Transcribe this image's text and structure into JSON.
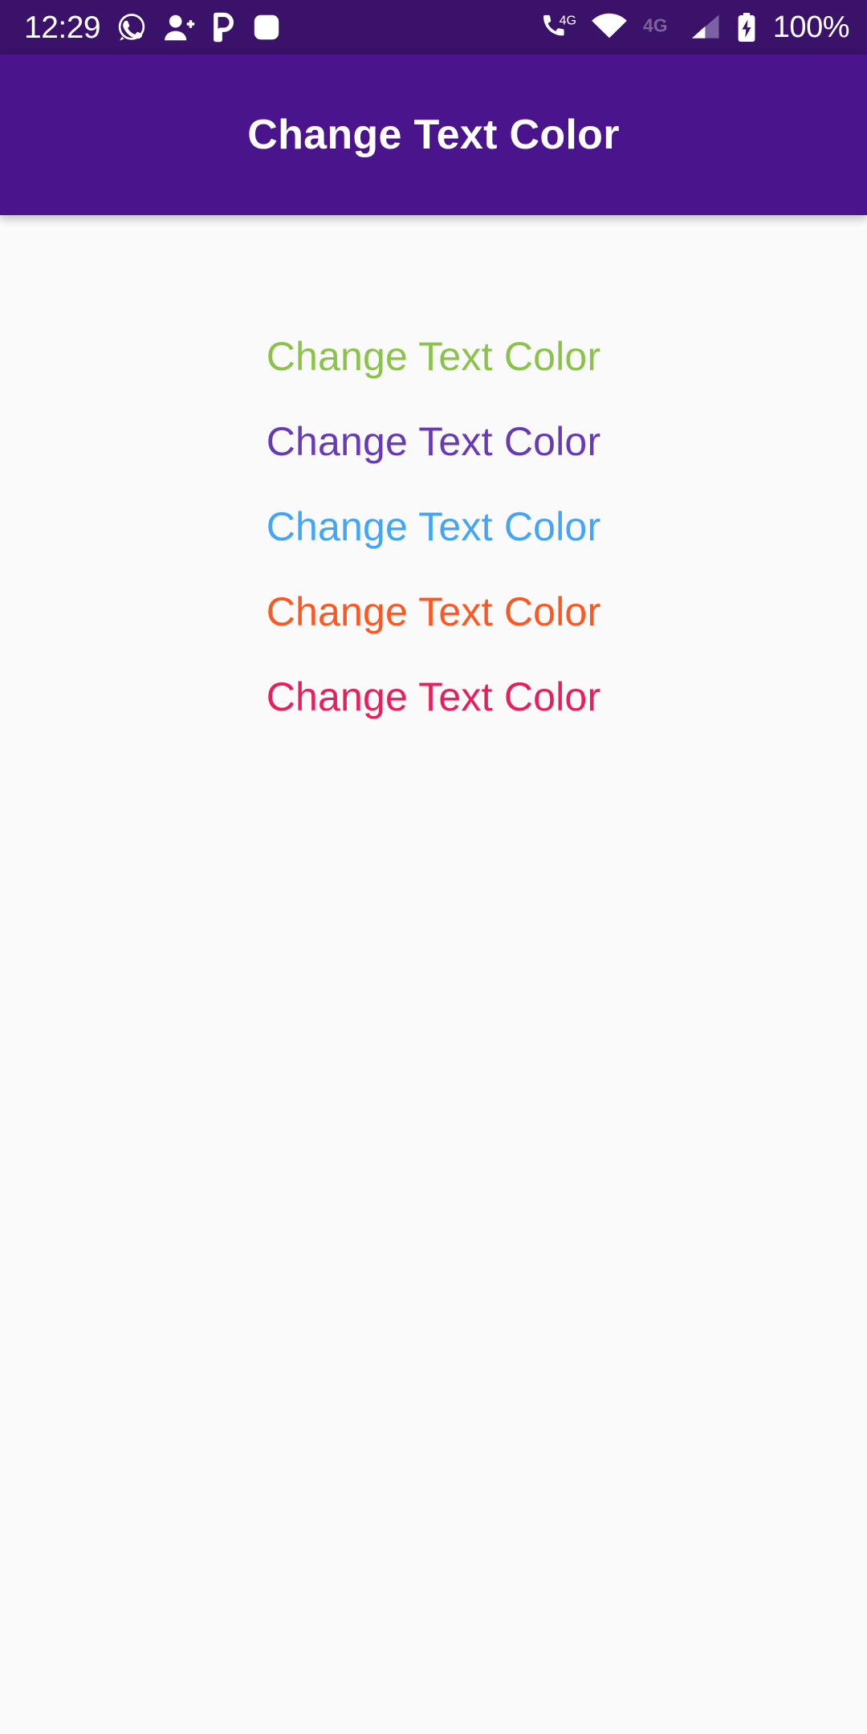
{
  "status_bar": {
    "time": "12:29",
    "battery_percent": "100%",
    "background_color": "#3a1269",
    "foreground_color": "#ffffff",
    "left_icons": [
      {
        "name": "whatsapp-icon",
        "label": "WhatsApp"
      },
      {
        "name": "add-person-icon",
        "label": "Contact added"
      },
      {
        "name": "letter-p-icon",
        "label": "P"
      },
      {
        "name": "rounded-square-icon",
        "label": "App notification"
      }
    ],
    "right_icons": [
      {
        "name": "volte-4g-call-icon",
        "label": "4G"
      },
      {
        "name": "wifi-icon",
        "label": "Wi-Fi"
      },
      {
        "name": "mobile-data-4g-icon",
        "label": "4G"
      },
      {
        "name": "signal-bars-icon",
        "label": "Signal"
      },
      {
        "name": "battery-charging-icon",
        "label": "Charging"
      }
    ]
  },
  "app_bar": {
    "title": "Change Text Color",
    "background_color": "#4a148c",
    "title_color": "#ffffff"
  },
  "content": {
    "background_color": "#fafafa",
    "lines": [
      {
        "text": "Change Text Color",
        "color": "#8bc34a",
        "color_name": "light-green"
      },
      {
        "text": "Change Text Color",
        "color": "#673ab7",
        "color_name": "deep-purple"
      },
      {
        "text": "Change Text Color",
        "color": "#42a5f5",
        "color_name": "light-blue"
      },
      {
        "text": "Change Text Color",
        "color": "#ff5722",
        "color_name": "deep-orange"
      },
      {
        "text": "Change Text Color",
        "color": "#e91e5c",
        "color_name": "pink"
      }
    ]
  }
}
